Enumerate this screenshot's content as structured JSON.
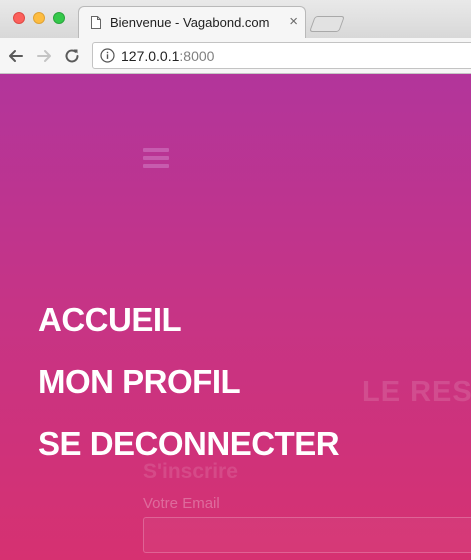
{
  "browser": {
    "tab": {
      "title": "Bienvenue - Vagabond.com",
      "close": "×"
    },
    "address": {
      "host": "127.0.0.1",
      "port": ":8000"
    }
  },
  "menu": {
    "items": [
      {
        "label": "ACCUEIL"
      },
      {
        "label": "MON PROFIL"
      },
      {
        "label": "SE DECONNECTER"
      }
    ]
  },
  "background": {
    "heading": "LE RES",
    "subheading": "S'inscrire",
    "email_label": "Votre Email"
  },
  "colors": {
    "gradient_top": "#b2359b",
    "gradient_bottom": "#d63171",
    "menu_text": "#ffffff"
  }
}
